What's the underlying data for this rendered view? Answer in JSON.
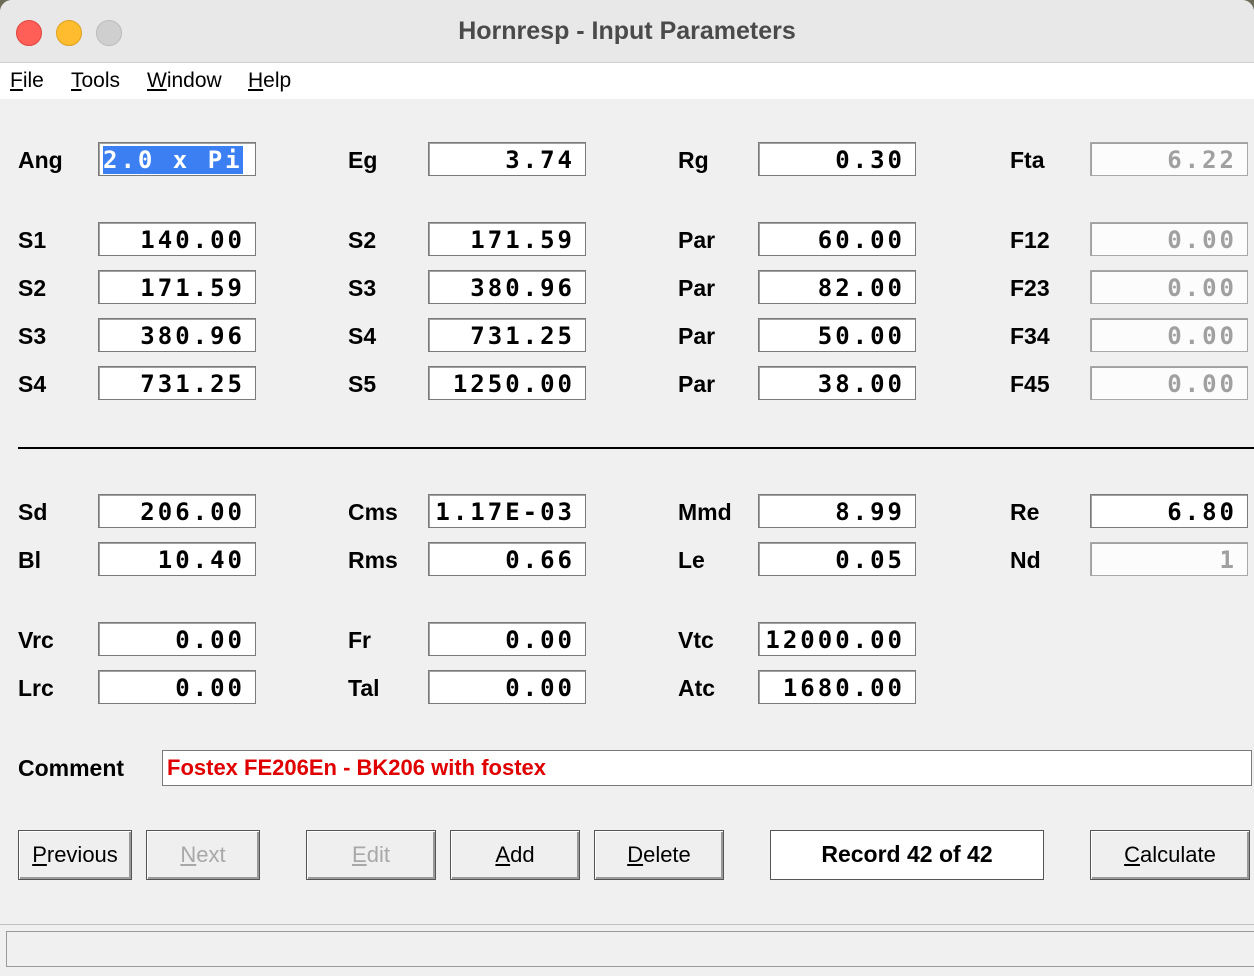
{
  "window": {
    "title": "Hornresp - Input Parameters"
  },
  "menu": [
    "File",
    "Tools",
    "Window",
    "Help"
  ],
  "rows": {
    "ang": {
      "l1": "Ang",
      "v1": "2.0 x Pi",
      "l2": "Eg",
      "v2": "3.74",
      "l3": "Rg",
      "v3": "0.30",
      "l4": "Fta",
      "v4": "6.22"
    },
    "s1": {
      "l1": "S1",
      "v1": "140.00",
      "l2": "S2",
      "v2": "171.59",
      "l3": "Par",
      "v3": "60.00",
      "l4": "F12",
      "v4": "0.00"
    },
    "s2": {
      "l1": "S2",
      "v1": "171.59",
      "l2": "S3",
      "v2": "380.96",
      "l3": "Par",
      "v3": "82.00",
      "l4": "F23",
      "v4": "0.00"
    },
    "s3": {
      "l1": "S3",
      "v1": "380.96",
      "l2": "S4",
      "v2": "731.25",
      "l3": "Par",
      "v3": "50.00",
      "l4": "F34",
      "v4": "0.00"
    },
    "s4": {
      "l1": "S4",
      "v1": "731.25",
      "l2": "S5",
      "v2": "1250.00",
      "l3": "Par",
      "v3": "38.00",
      "l4": "F45",
      "v4": "0.00"
    },
    "sd": {
      "l1": "Sd",
      "v1": "206.00",
      "l2": "Cms",
      "v2": "1.17E-03",
      "l3": "Mmd",
      "v3": "8.99",
      "l4": "Re",
      "v4": "6.80"
    },
    "bl": {
      "l1": "Bl",
      "v1": "10.40",
      "l2": "Rms",
      "v2": "0.66",
      "l3": "Le",
      "v3": "0.05",
      "l4": "Nd",
      "v4": "1"
    },
    "vrc": {
      "l1": "Vrc",
      "v1": "0.00",
      "l2": "Fr",
      "v2": "0.00",
      "l3": "Vtc",
      "v3": "12000.00"
    },
    "lrc": {
      "l1": "Lrc",
      "v1": "0.00",
      "l2": "Tal",
      "v2": "0.00",
      "l3": "Atc",
      "v3": "1680.00"
    }
  },
  "comment": {
    "label": "Comment",
    "value": "Fostex FE206En - BK206 with fostex"
  },
  "buttons": {
    "previous": {
      "first": "P",
      "rest": "revious"
    },
    "next": {
      "first": "N",
      "rest": "ext"
    },
    "edit": {
      "first": "E",
      "rest": "dit"
    },
    "add": {
      "first": "A",
      "rest": "dd"
    },
    "delete": {
      "first": "D",
      "rest": "elete"
    },
    "calculate": {
      "first": "C",
      "rest": "alculate"
    }
  },
  "record": "Record 42 of 42",
  "colors": {
    "comment_text": "#e00000",
    "selection": "#3b7ff2",
    "disabled_text": "#a0a0a0"
  }
}
